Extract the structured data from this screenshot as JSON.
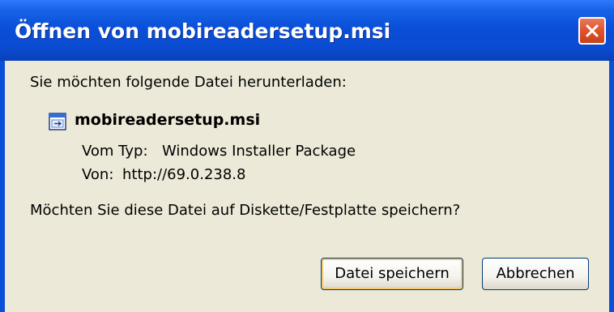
{
  "dialog": {
    "title": "Öffnen von mobireadersetup.msi",
    "prompt": "Sie möchten folgende Datei herunterladen:",
    "file": {
      "name": "mobireadersetup.msi",
      "type_label": "Vom Typ:",
      "type_value": "Windows Installer Package",
      "from_label": "Von:",
      "from_value": "http://69.0.238.8"
    },
    "question": "Möchten Sie diese Datei auf Diskette/Festplatte speichern?",
    "buttons": {
      "save": "Datei speichern",
      "cancel": "Abbrechen"
    }
  },
  "icons": {
    "close": "close-icon",
    "file": "msi-file-icon"
  },
  "colors": {
    "titlebar": "#0a4fd8",
    "close_button": "#e2542f",
    "dialog_background": "#ece9d8",
    "default_button_ring": "#f3c870"
  }
}
